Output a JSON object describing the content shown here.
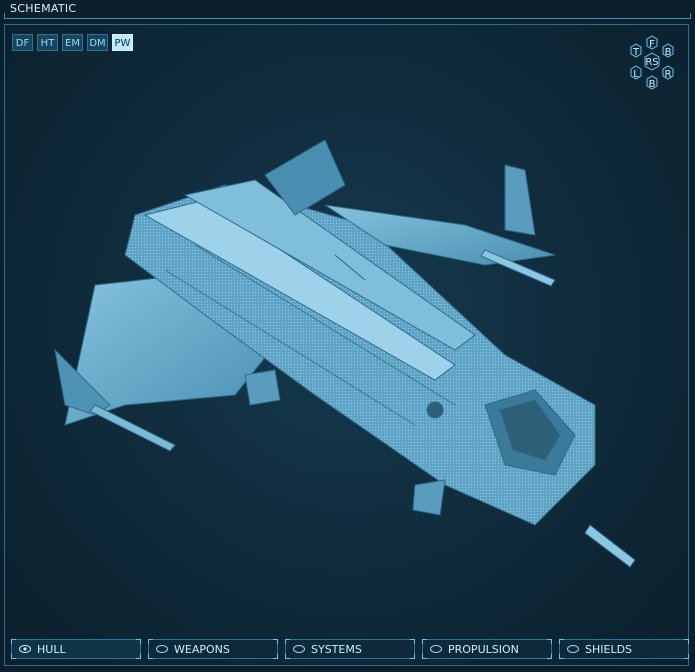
{
  "header": {
    "title": "SCHEMATIC"
  },
  "modes": [
    {
      "label": "DF",
      "active": false
    },
    {
      "label": "HT",
      "active": false
    },
    {
      "label": "EM",
      "active": false
    },
    {
      "label": "DM",
      "active": false
    },
    {
      "label": "PW",
      "active": true
    }
  ],
  "view_selector": {
    "top": "T",
    "front": "F",
    "back_top": "B",
    "reset": "RS",
    "left": "L",
    "right": "R",
    "bottom": "B"
  },
  "tabs": [
    {
      "label": "HULL",
      "icon": "eye-icon",
      "active": true
    },
    {
      "label": "WEAPONS",
      "icon": "eye-closed-icon",
      "active": false
    },
    {
      "label": "SYSTEMS",
      "icon": "eye-closed-icon",
      "active": false
    },
    {
      "label": "PROPULSION",
      "icon": "eye-closed-icon",
      "active": false
    },
    {
      "label": "SHIELDS",
      "icon": "eye-closed-icon",
      "active": false
    }
  ],
  "colors": {
    "accent": "#3c93b8",
    "active_tab": "#bfe9fb",
    "hull": "#6fb0cf"
  }
}
